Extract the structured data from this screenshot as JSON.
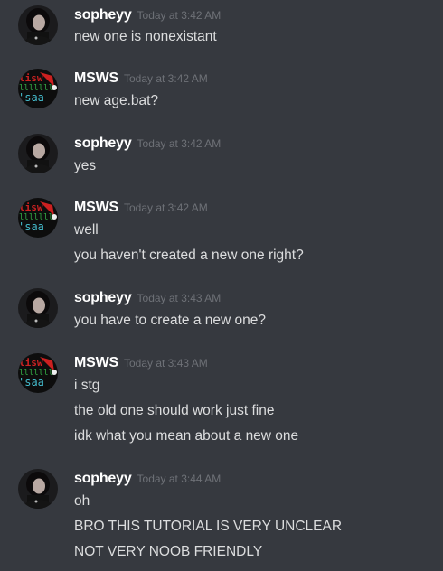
{
  "messages": [
    {
      "author": "sopheyy",
      "avatar_icon": "sopheyy-avatar-icon",
      "timestamp": "Today at 3:42 AM",
      "lines": [
        "new one is nonexistant"
      ]
    },
    {
      "author": "MSWS",
      "avatar_icon": "msws-avatar-icon",
      "timestamp": "Today at 3:42 AM",
      "lines": [
        "new age.bat?"
      ]
    },
    {
      "author": "sopheyy",
      "avatar_icon": "sopheyy-avatar-icon",
      "timestamp": "Today at 3:42 AM",
      "lines": [
        "yes"
      ]
    },
    {
      "author": "MSWS",
      "avatar_icon": "msws-avatar-icon",
      "timestamp": "Today at 3:42 AM",
      "lines": [
        "well",
        "you haven't created a new one right?"
      ]
    },
    {
      "author": "sopheyy",
      "avatar_icon": "sopheyy-avatar-icon",
      "timestamp": "Today at 3:43 AM",
      "lines": [
        "you have to create a new one?"
      ]
    },
    {
      "author": "MSWS",
      "avatar_icon": "msws-avatar-icon",
      "timestamp": "Today at 3:43 AM",
      "lines": [
        "i stg",
        "the old one should work just fine",
        "idk what you mean about a new one"
      ]
    },
    {
      "author": "sopheyy",
      "avatar_icon": "sopheyy-avatar-icon",
      "timestamp": "Today at 3:44 AM",
      "lines": [
        "oh",
        "BRO THIS TUTORIAL IS VERY UNCLEAR",
        "NOT VERY NOOB FRIENDLY"
      ]
    }
  ],
  "colors": {
    "background": "#36393f",
    "username": "#ffffff",
    "timestamp": "#72767d",
    "message_text": "#dcddde"
  }
}
